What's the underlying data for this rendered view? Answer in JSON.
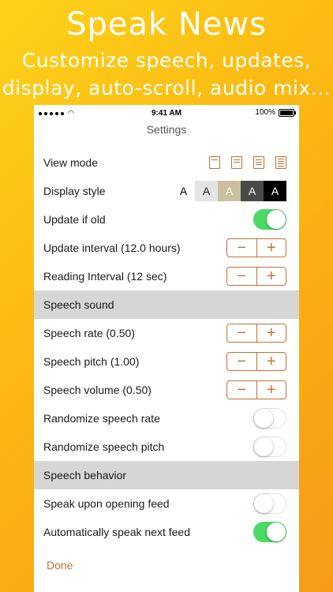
{
  "promo": {
    "title": "Speak News",
    "subtitle_line1": "Customize speech, updates,",
    "subtitle_line2": "display, auto-scroll, audio mix..."
  },
  "status_bar": {
    "time": "9:41 AM",
    "battery": "100%"
  },
  "nav": {
    "title": "Settings"
  },
  "settings": {
    "view_mode": "View mode",
    "display_style": "Display style",
    "display_style_options": [
      "A",
      "A",
      "A",
      "A",
      "A"
    ],
    "update_if_old": "Update if old",
    "update_interval": "Update interval (12.0 hours)",
    "reading_interval": "Reading Interval (12 sec)",
    "speech_sound_header": "Speech sound",
    "speech_rate": "Speech rate (0.50)",
    "speech_pitch": "Speech pitch (1.00)",
    "speech_volume": "Speech volume (0.50)",
    "randomize_rate": "Randomize speech rate",
    "randomize_pitch": "Randomize speech pitch",
    "speech_behavior_header": "Speech behavior",
    "speak_upon_opening": "Speak upon opening feed",
    "auto_speak_next": "Automatically speak next feed"
  },
  "stepper": {
    "minus": "−",
    "plus": "+"
  },
  "toggles": {
    "update_if_old": true,
    "randomize_rate": false,
    "randomize_pitch": false,
    "speak_upon_opening": false,
    "auto_speak_next": true
  },
  "done_label": "Done",
  "colors": {
    "accent": "#c87032",
    "toggle_on": "#4cd964",
    "section_bg": "#d6d6d6",
    "background_top": "#fdd21a",
    "background_bottom": "#f79a18"
  }
}
